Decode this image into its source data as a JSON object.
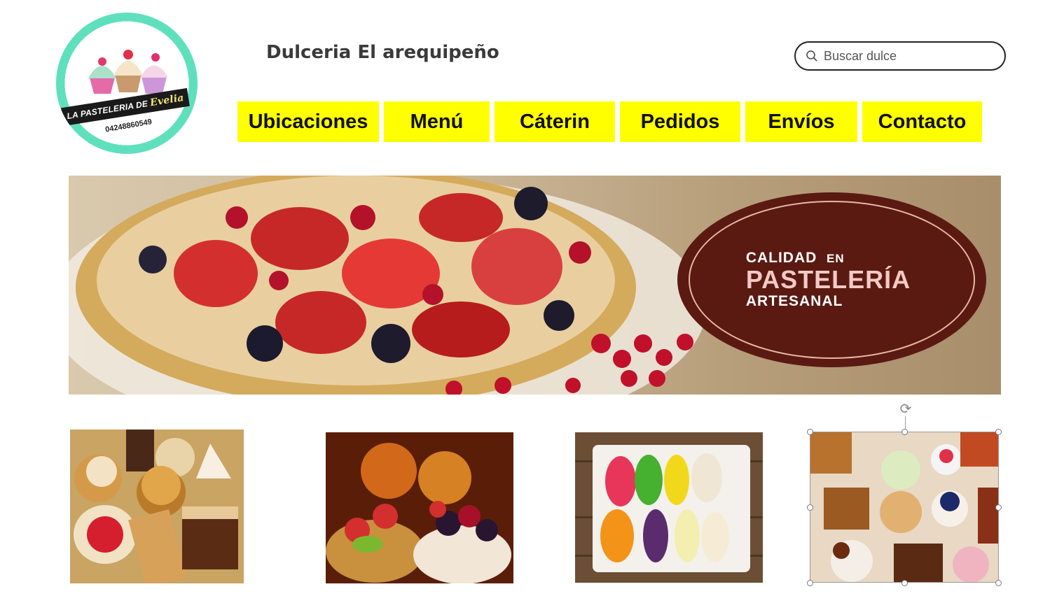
{
  "site": {
    "title": "Dulceria El arequipeño",
    "logo": {
      "name_part1": "LA PASTELERIA DE",
      "name_part2": "Evelia",
      "phone": "04248860549"
    }
  },
  "search": {
    "placeholder": "Buscar dulce",
    "value": ""
  },
  "nav": {
    "items": [
      {
        "label": "Ubicaciones"
      },
      {
        "label": "Menú"
      },
      {
        "label": "Cáterin"
      },
      {
        "label": "Pedidos"
      },
      {
        "label": "Envíos"
      },
      {
        "label": "Contacto"
      }
    ]
  },
  "hero": {
    "badge_line1_a": "CALIDAD",
    "badge_line1_b": "EN",
    "badge_line2": "PASTELERÍA",
    "badge_line3": "ARTESANAL"
  },
  "thumbnails": [
    {
      "subject": "assorted pastries"
    },
    {
      "subject": "fruit tarts"
    },
    {
      "subject": "macarons box"
    },
    {
      "subject": "mini cakes assortment",
      "selected": true
    }
  ],
  "colors": {
    "nav_bg": "#ffff00",
    "badge_bg": "#5a1a12",
    "logo_mint": "#5fe0bd"
  }
}
